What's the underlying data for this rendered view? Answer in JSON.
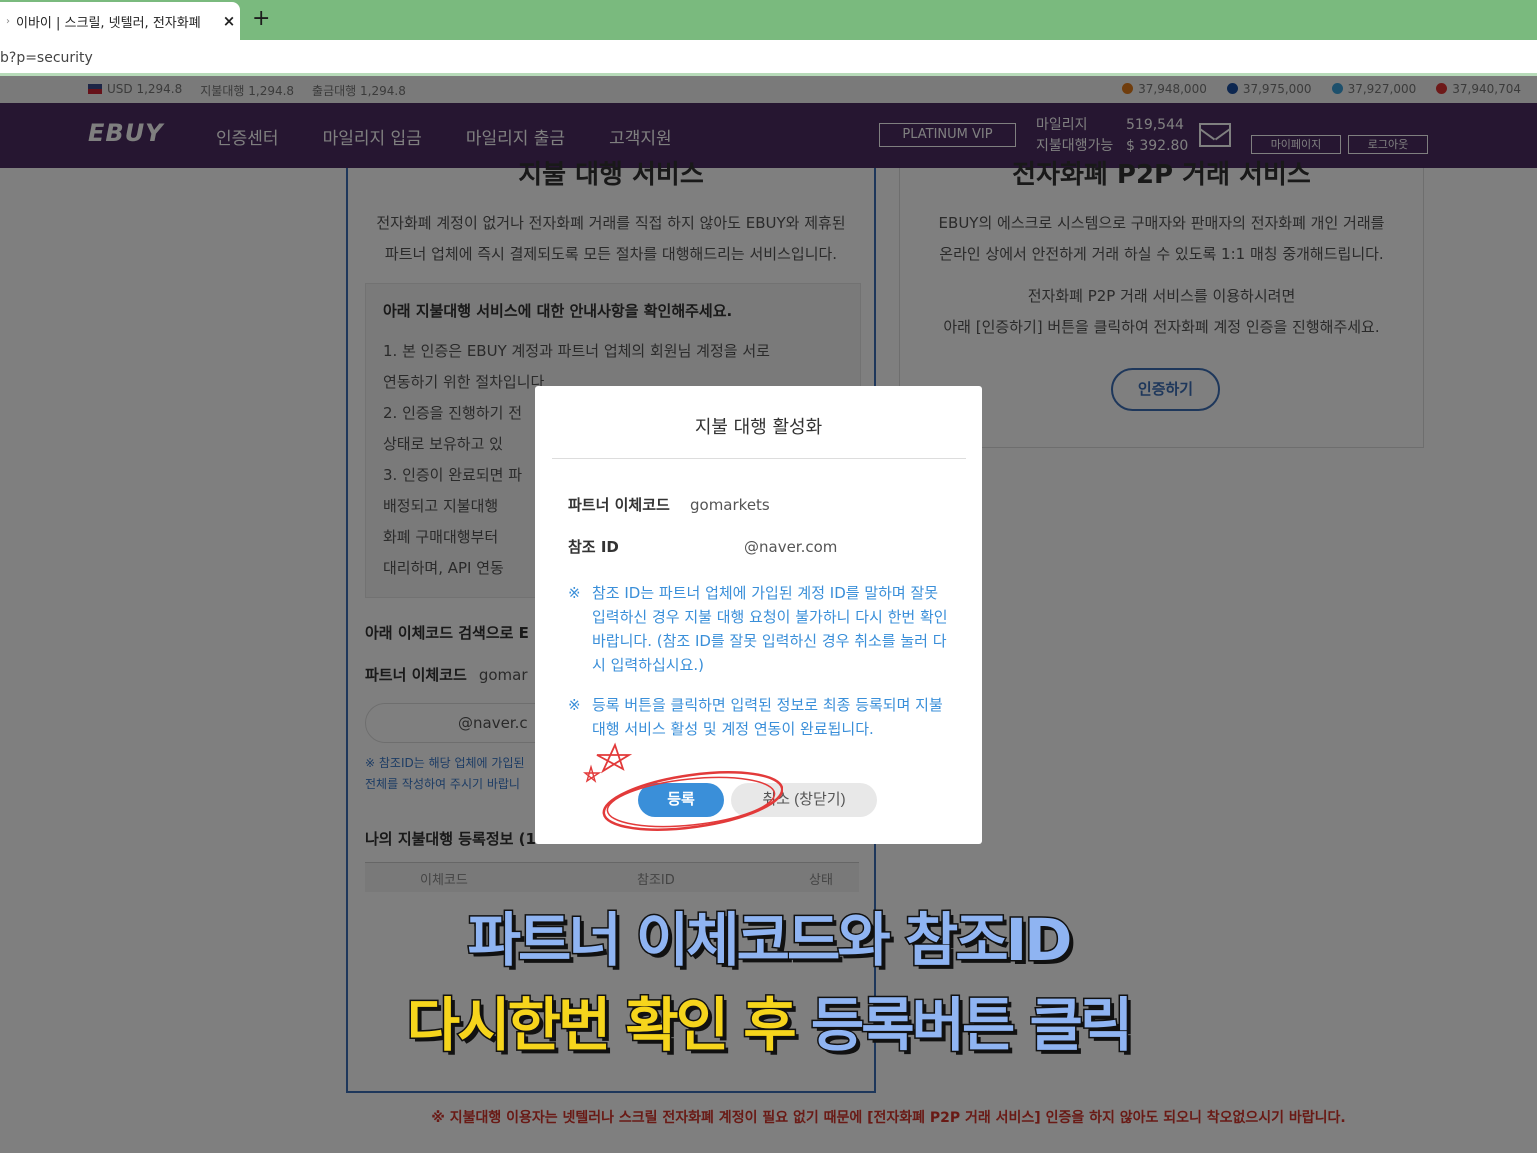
{
  "browser": {
    "tab_title": "이바이 | 스크릴, 넷텔러, 전자화폐",
    "tab_close": "×",
    "new_tab": "+",
    "url": "b?p=security"
  },
  "ticker": {
    "usd": "USD 1,294.8",
    "payment": "지불대행 1,294.8",
    "withdraw": "출금대행 1,294.8",
    "coins": [
      {
        "value": "37,948,000",
        "color": "#e07a1a"
      },
      {
        "value": "37,975,000",
        "color": "#1a4fa0"
      },
      {
        "value": "37,927,000",
        "color": "#3aa0d8"
      },
      {
        "value": "37,940,704",
        "color": "#d33"
      }
    ]
  },
  "nav": {
    "logo": "EBUY",
    "menu": [
      "인증센터",
      "마일리지 입금",
      "마일리지 출금",
      "고객지원"
    ],
    "vip": "PLATINUM VIP",
    "mileage_label": "마일리지",
    "mileage_value": "519,544",
    "payable_label": "지불대행가능",
    "payable_value": "$ 392.80",
    "mypage": "마이페이지",
    "logout": "로그아웃"
  },
  "left_panel": {
    "title": "지불 대행 서비스",
    "desc1": "전자화폐 계정이 없거나 전자화폐 거래를 직접 하지 않아도 EBUY와 제휴된",
    "desc2": "파트너 업체에 즉시 결제되도록 모든 절차를 대행해드리는 서비스입니다.",
    "notice_title": "아래 지불대행 서비스에 대한 안내사항을 확인해주세요.",
    "notice_items": [
      "1.  본 인증은 EBUY 계정과 파트너 업체의 회원님 계정을 서로",
      "     연동하기 위한 절차입니다",
      "2.  인증을 진행하기 전",
      "     상태로 보유하고 있",
      "3.  인증이 완료되면 파",
      "     배정되고 지불대행 ",
      "     화폐 구매대행부터 ",
      "     대리하며, API 연동 "
    ],
    "search_title": "아래 이체코드 검색으로 E",
    "partner_label": "파트너 이체코드",
    "partner_value": "gomar",
    "input_value": "@naver.c",
    "note1": "※ 참조ID는 해당 업체에 가입된",
    "note2": "전체를 작성하여 주시기 바랍니",
    "reg_title": "나의 지불대행 등록정보 (1",
    "reg_cols": [
      "이체코드",
      "참조ID",
      "상태"
    ]
  },
  "right_panel": {
    "title": "전자화폐 P2P 거래 서비스",
    "desc1": "EBUY의 에스크로 시스템으로 구매자와 판매자의 전자화폐 개인 거래를",
    "desc2": "온라인 상에서 안전하게 거래 하실 수 있도록 1:1 매칭 중개해드립니다.",
    "desc3": "전자화폐 P2P 거래 서비스를 이용하시려면",
    "desc4": "아래 [인증하기] 버튼을 클릭하여 전자화폐 계정 인증을 진행해주세요.",
    "button": "인증하기"
  },
  "footnote": "※ 지불대행 이용자는 넷텔러나 스크릴 전자화폐 계정이 필요 없기 때문에 [전자화폐 P2P 거래 서비스] 인증을 하지 않아도 되오니 착오없으시기 바랍니다.",
  "modal": {
    "title": "지불 대행 활성화",
    "partner_label": "파트너 이체코드",
    "partner_value": "gomarkets",
    "ref_label": "참조 ID",
    "ref_value": "@naver.com",
    "note_mark": "※",
    "note1": "참조 ID는 파트너 업체에 가입된 계정 ID를 말하며 잘못 입력하신 경우 지불 대행 요청이 불가하니 다시 한번 확인바랍니다. (참조 ID를 잘못 입력하신 경우 취소를 눌러 다시 입력하십시요.)",
    "note2": "등록 버튼을 클릭하면 입력된 정보로 최종 등록되며 지불대행 서비스 활성 및 계정 연동이 완료됩니다.",
    "ok": "등록",
    "cancel": "취소 (창닫기)"
  },
  "caption": {
    "line1": "파트너 이체코드와 참조ID",
    "line2_a": "다시한번 확인 후 ",
    "line2_b": "등록버튼 클릭"
  }
}
